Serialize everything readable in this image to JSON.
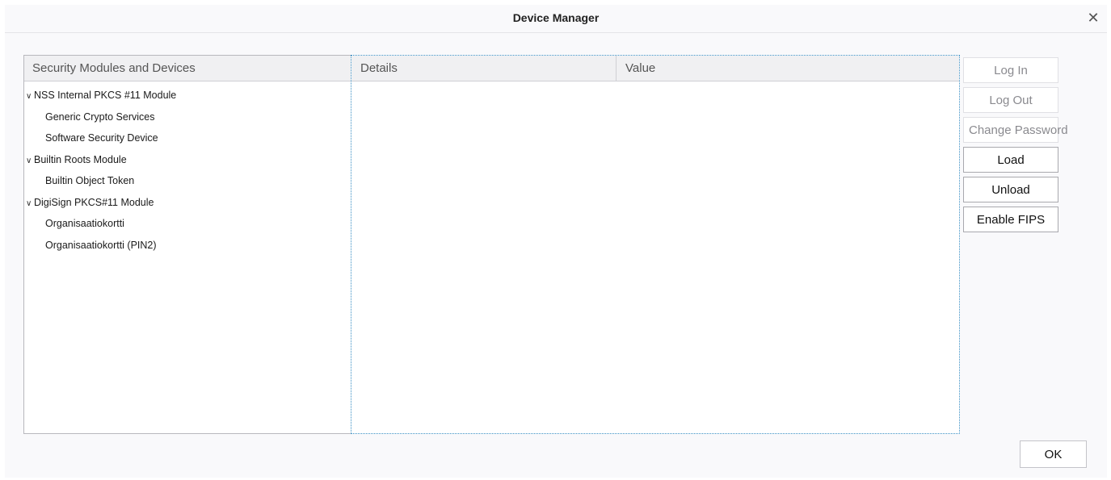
{
  "window": {
    "title": "Device Manager",
    "close_glyph": "✕"
  },
  "tree": {
    "header": "Security Modules and Devices",
    "rows": [
      {
        "type": "module",
        "label": "NSS Internal PKCS #11 Module",
        "expanded": true
      },
      {
        "type": "slot",
        "label": "Generic Crypto Services"
      },
      {
        "type": "slot",
        "label": "Software Security Device"
      },
      {
        "type": "module",
        "label": "Builtin Roots Module",
        "expanded": true
      },
      {
        "type": "slot",
        "label": "Builtin Object Token"
      },
      {
        "type": "module",
        "label": "DigiSign PKCS#11 Module",
        "expanded": true
      },
      {
        "type": "slot",
        "label": "Organisaatiokortti"
      },
      {
        "type": "slot",
        "label": "Organisaatiokortti (PIN2)"
      }
    ],
    "expand_icon_glyph": "∨"
  },
  "details": {
    "header_details": "Details",
    "header_value": "Value"
  },
  "buttons": {
    "log_in": {
      "label": "Log In",
      "enabled": false
    },
    "log_out": {
      "label": "Log Out",
      "enabled": false
    },
    "change_password": {
      "label": "Change Password",
      "enabled": false
    },
    "load": {
      "label": "Load",
      "enabled": true
    },
    "unload": {
      "label": "Unload",
      "enabled": true
    },
    "enable_fips": {
      "label": "Enable FIPS",
      "enabled": true
    },
    "ok": {
      "label": "OK",
      "enabled": true
    }
  },
  "colors": {
    "dialog_bg": "#f9f9fb",
    "focus_border": "#3a8fc4",
    "disabled_text": "#8a8a8f"
  }
}
